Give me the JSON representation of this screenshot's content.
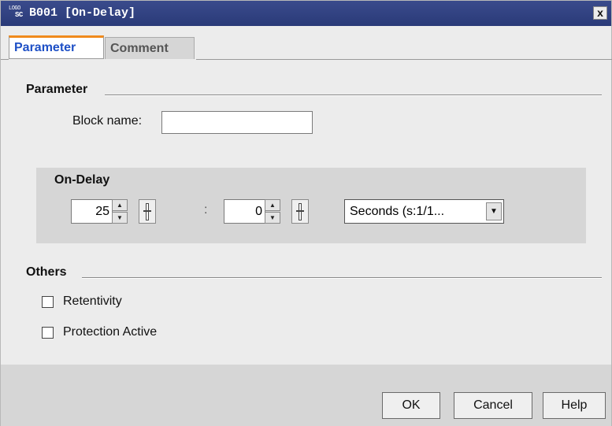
{
  "window": {
    "title": "B001 [On-Delay]",
    "logo_line1": "LOGO",
    "logo_line2": "SC",
    "close_label": "x"
  },
  "tabs": [
    {
      "label": "Parameter",
      "active": true
    },
    {
      "label": "Comment",
      "active": false
    }
  ],
  "parameter_group": {
    "title": "Parameter",
    "block_name_label": "Block name:",
    "block_name_value": ""
  },
  "on_delay": {
    "title": "On-Delay",
    "value1": "25",
    "separator": ":",
    "value2": "0",
    "timebase_selected": "Seconds (s:1/1..."
  },
  "others_group": {
    "title": "Others",
    "retentivity_label": "Retentivity",
    "retentivity_checked": false,
    "protection_label": "Protection Active",
    "protection_checked": false
  },
  "buttons": {
    "ok": "OK",
    "cancel": "Cancel",
    "help": "Help"
  },
  "colors": {
    "titlebar": "#2a3a78",
    "active_tab_text": "#1e50c6",
    "active_tab_accent": "#f08a1c",
    "dialog_bg": "#ececec",
    "panel_bg": "#d6d6d6"
  }
}
